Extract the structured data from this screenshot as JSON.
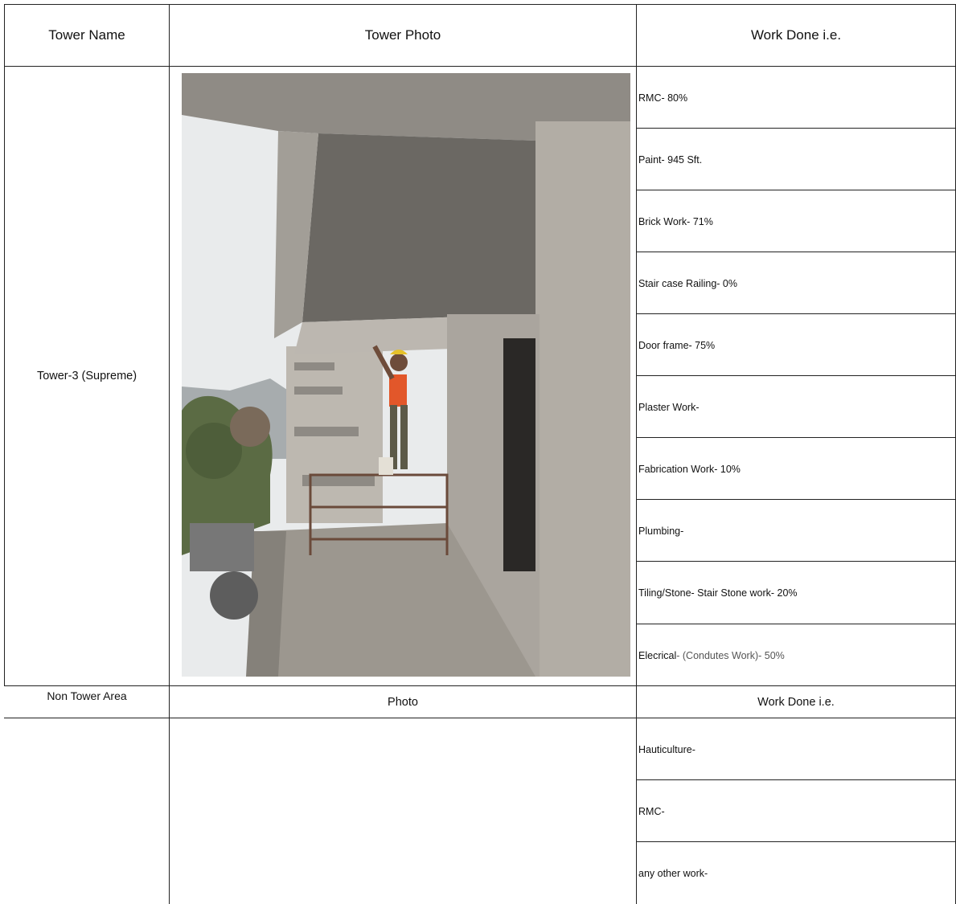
{
  "top_header": {
    "col1": "Tower Name",
    "col2": "Tower Photo",
    "col3": "Work Done i.e."
  },
  "tower": {
    "name": "Tower-3 (Supreme)",
    "items": [
      "RMC- 80%",
      "Paint- 945 Sft.",
      "Brick Work- 71%",
      "Stair case Railing- 0%",
      "Door frame- 75%",
      "Plaster Work-",
      "Fabrication Work- 10%",
      "Plumbing-",
      "Tiling/Stone- Stair Stone work- 20%"
    ],
    "electrical_prefix": "Elecrical",
    "electrical_rest": "- (Condutes Work)- 50%"
  },
  "non_tower_header": {
    "col1": "Non Tower Area",
    "col2": "Photo",
    "col3": "Work Done i.e."
  },
  "non_tower_items": [
    "Hauticulture-",
    "RMC-",
    "any other work-"
  ],
  "colors": {
    "border": "#222222",
    "text": "#111111"
  }
}
